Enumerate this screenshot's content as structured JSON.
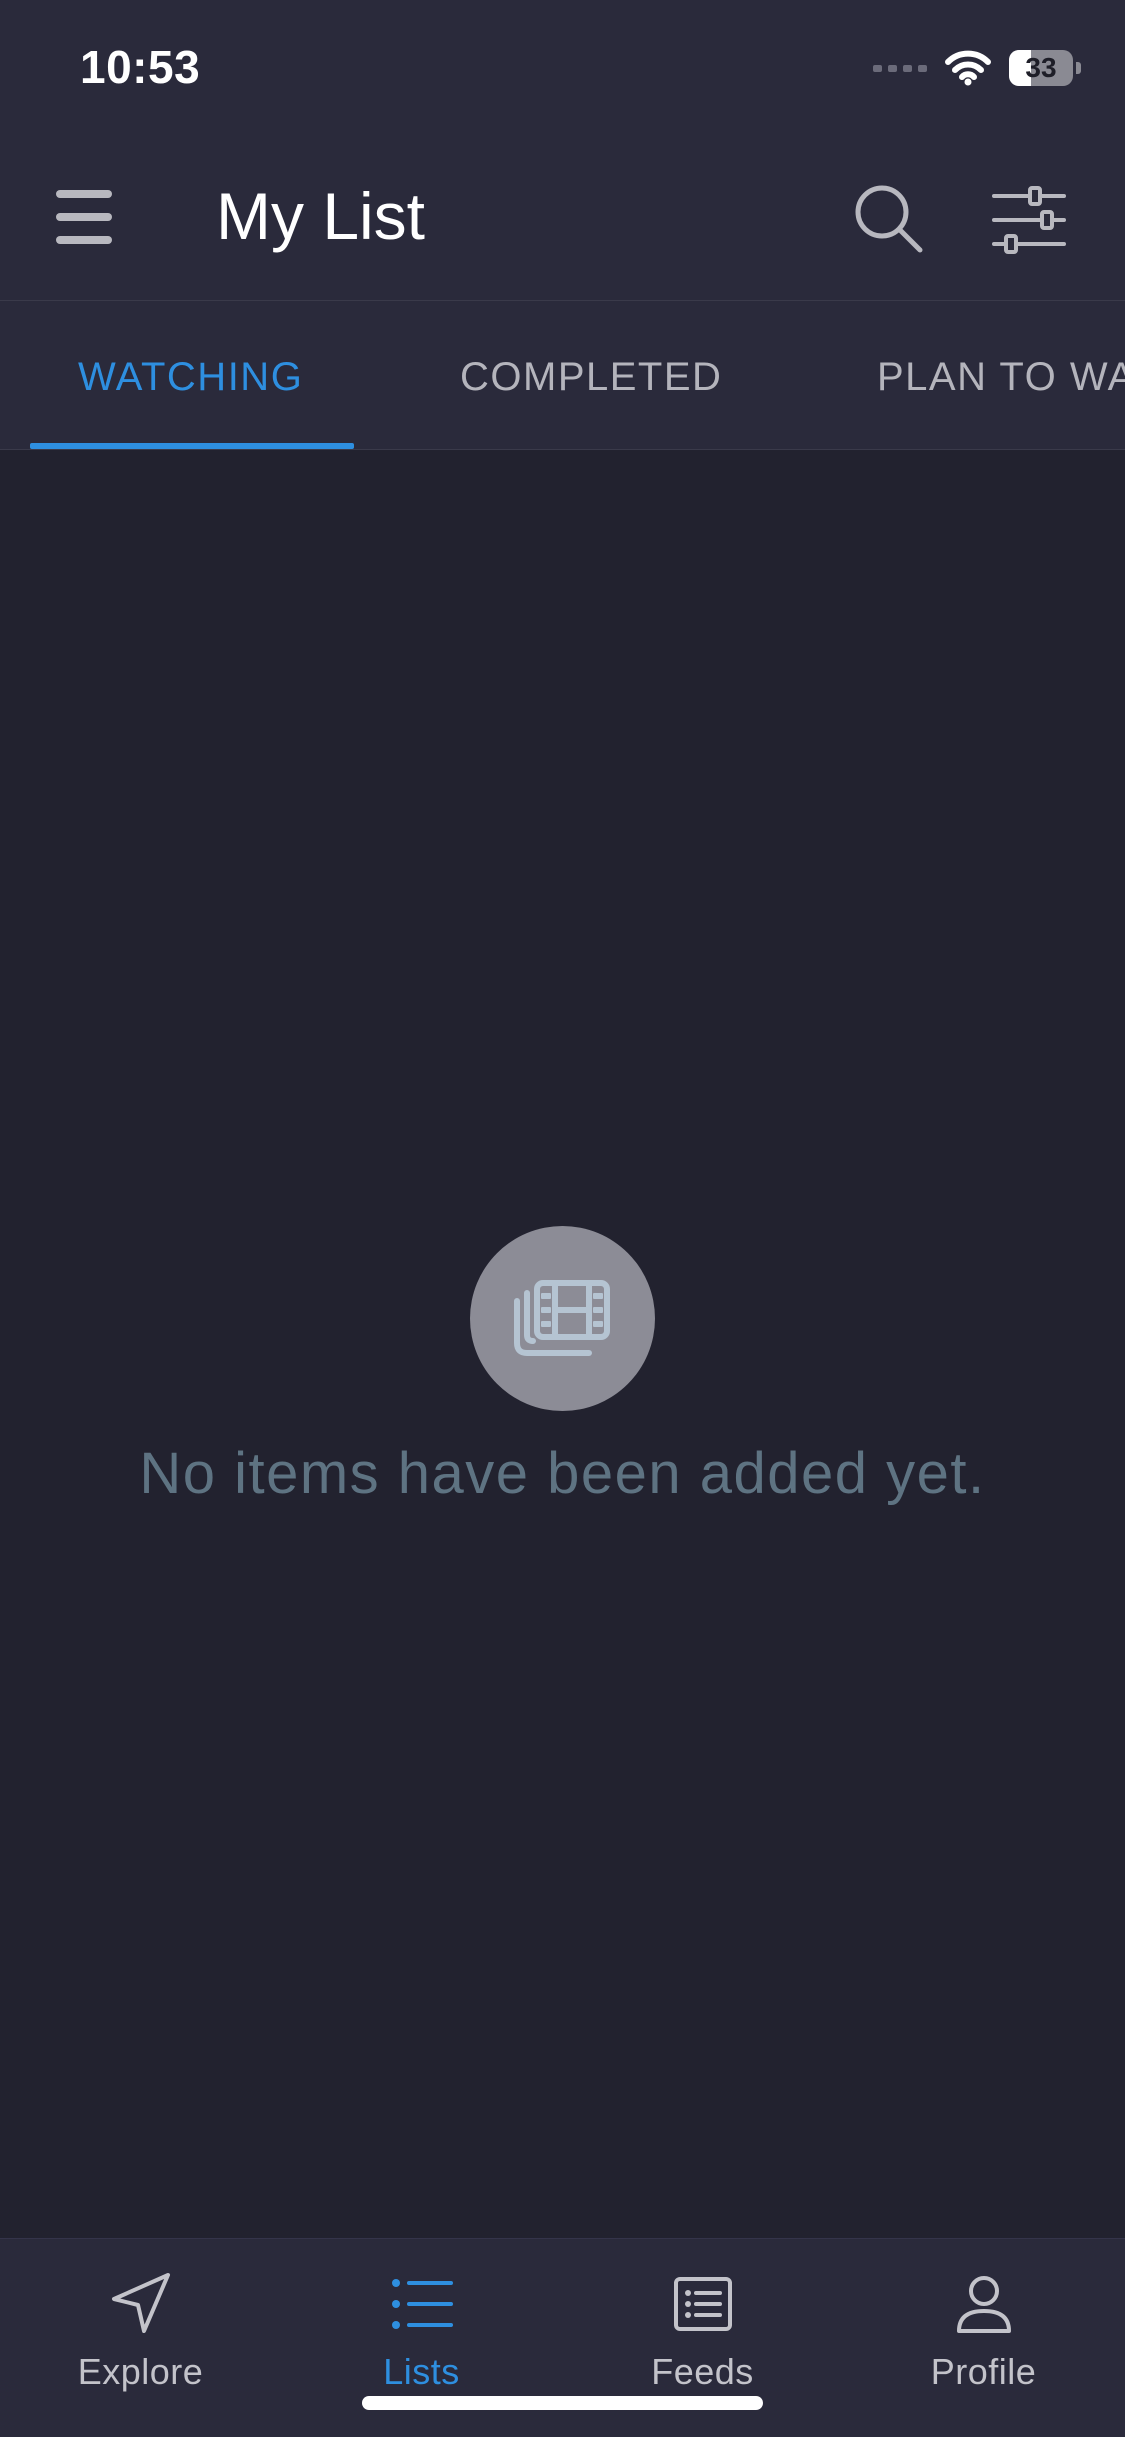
{
  "status_bar": {
    "time": "10:53",
    "battery": "33"
  },
  "header": {
    "title": "My List"
  },
  "tabs": [
    {
      "label": "WATCHING",
      "active": true
    },
    {
      "label": "COMPLETED",
      "active": false
    },
    {
      "label": "PLAN TO WATCH",
      "active": false
    }
  ],
  "empty_state": {
    "message": "No items have been added yet.",
    "icon": "film-stack-icon"
  },
  "bottom_nav": [
    {
      "label": "Explore",
      "icon": "navigation-arrow-icon",
      "active": false
    },
    {
      "label": "Lists",
      "icon": "list-icon",
      "active": true
    },
    {
      "label": "Feeds",
      "icon": "news-feed-icon",
      "active": false
    },
    {
      "label": "Profile",
      "icon": "person-icon",
      "active": false
    }
  ],
  "colors": {
    "accent": "#2e8fe0",
    "background": "#22222f",
    "bar": "#2a2a3b",
    "empty_text": "#5e7382"
  }
}
